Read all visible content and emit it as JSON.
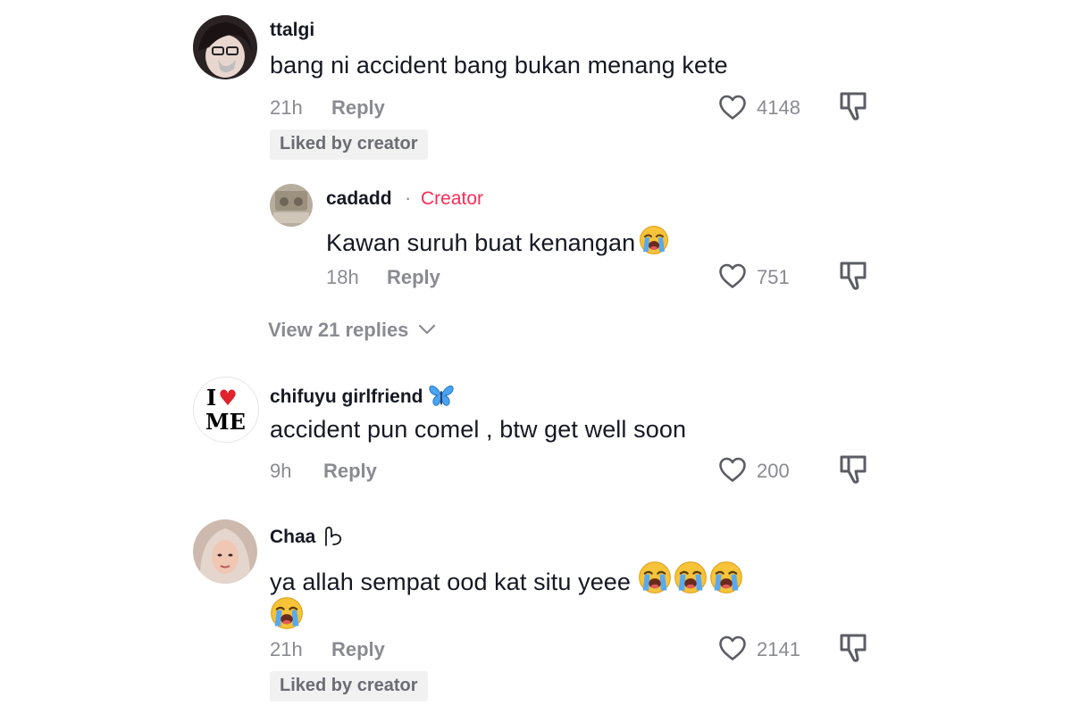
{
  "comments": [
    {
      "username": "ttalgi",
      "text": "bang ni accident bang bukan menang kete",
      "time": "21h",
      "reply_label": "Reply",
      "likes": "4148",
      "badge": "Liked by creator",
      "replies": [
        {
          "username": "cadadd",
          "creator_label": "Creator",
          "text": "Kawan suruh buat kenangan",
          "time": "18h",
          "reply_label": "Reply",
          "likes": "751"
        }
      ],
      "view_replies": {
        "prefix": "View",
        "count": "21",
        "suffix": "replies"
      }
    },
    {
      "username": "chifuyu girlfriend",
      "avatar_text_top": "I",
      "avatar_text_bottom": "ME",
      "text": "accident pun comel , btw get well soon",
      "time": "9h",
      "reply_label": "Reply",
      "likes": "200"
    },
    {
      "username": "Chaa",
      "text": "ya allah sempat ood kat situ yeee",
      "time": "21h",
      "reply_label": "Reply",
      "likes": "2141",
      "badge": "Liked by creator"
    }
  ],
  "icons": {
    "like": "heart-outline-icon",
    "dislike": "thumbs-down-icon",
    "chevron": "chevron-down-icon",
    "emoji": "loudly-crying-face-emoji",
    "butterfly": "butterfly-emoji"
  },
  "colors": {
    "text": "#161823",
    "secondary": "#8a8b91",
    "creator": "#fe2c55",
    "badge_bg": "#f1f1f2"
  }
}
